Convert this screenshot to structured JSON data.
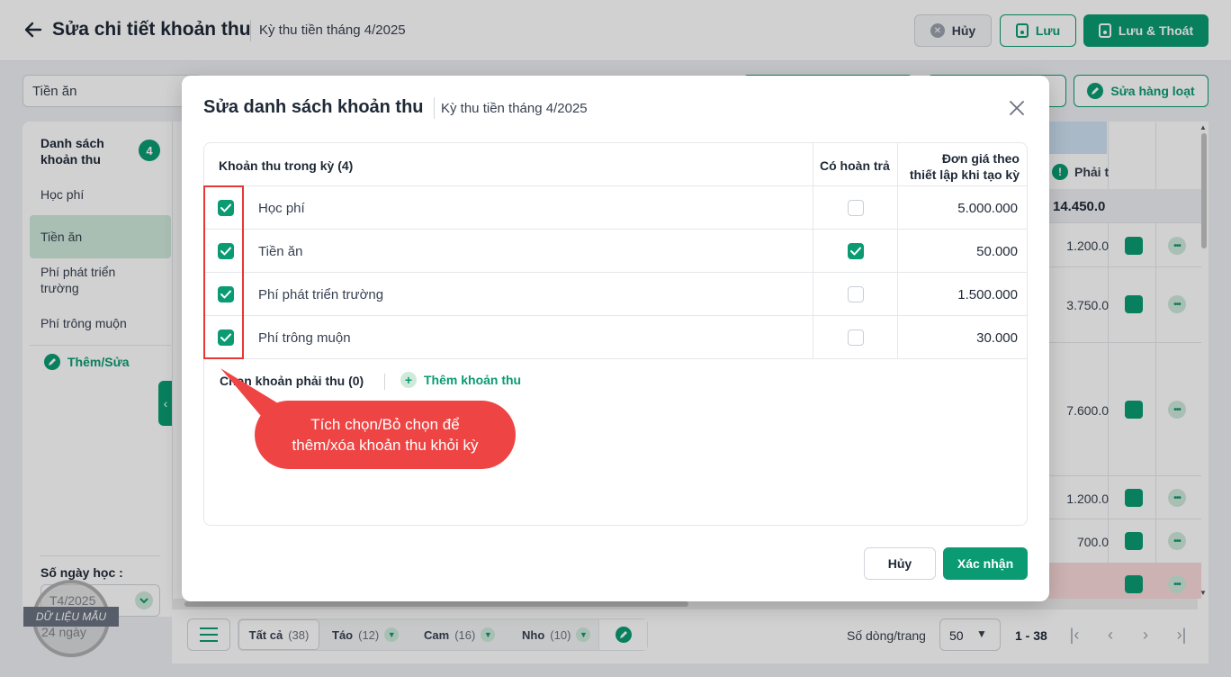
{
  "header": {
    "title": "Sửa chi tiết khoản thu",
    "subtitle": "Kỳ thu tiền tháng 4/2025",
    "cancel_label": "Hủy",
    "save_label": "Lưu",
    "save_exit_label": "Lưu & Thoát"
  },
  "toolbar": {
    "filter_value": "Tiền ăn",
    "bulk_edit_label": "Sửa hàng loạt"
  },
  "sidebar": {
    "title": "Danh sách khoản thu",
    "count": "4",
    "items": [
      {
        "label": "Học phí"
      },
      {
        "label": "Tiền ăn"
      },
      {
        "label": "Phí phát triển trường"
      },
      {
        "label": "Phí trông muộn"
      }
    ],
    "active_index": 1,
    "add_edit_label": "Thêm/Sửa",
    "days_label": "Số ngày học :",
    "days_select": "T4/2025",
    "days_value": "24 ngày"
  },
  "grid": {
    "column_header": "Phải t",
    "total": "14.450.0",
    "values": [
      "1.200.0",
      "3.750.0",
      "7.600.0",
      "1.200.0",
      "700.0"
    ]
  },
  "footer": {
    "tabs": [
      {
        "label": "Tất cả",
        "count": "(38)"
      },
      {
        "label": "Táo",
        "count": "(12)"
      },
      {
        "label": "Cam",
        "count": "(16)"
      },
      {
        "label": "Nho",
        "count": "(10)"
      }
    ],
    "rows_label": "Số dòng/trang",
    "rows_value": "50",
    "range": "1 - 38"
  },
  "watermark": {
    "label": "DỮ LIỆU MẪU"
  },
  "modal": {
    "title": "Sửa danh sách khoản thu",
    "subtitle": "Kỳ thu tiền tháng 4/2025",
    "table": {
      "col_name": "Khoản thu trong kỳ (4)",
      "col_refund": "Có hoàn trả",
      "col_price_line1": "Đơn giá theo",
      "col_price_line2": "thiết lập khi tạo kỳ",
      "rows": [
        {
          "name": "Học phí",
          "selected": true,
          "refund": false,
          "price": "5.000.000"
        },
        {
          "name": "Tiền ăn",
          "selected": true,
          "refund": true,
          "price": "50.000"
        },
        {
          "name": "Phí phát triển trường",
          "selected": true,
          "refund": false,
          "price": "1.500.000"
        },
        {
          "name": "Phí trông muộn",
          "selected": true,
          "refund": false,
          "price": "30.000"
        }
      ]
    },
    "section_label": "Chọn khoản phải thu (0)",
    "add_label": "Thêm khoản thu",
    "cancel_label": "Hủy",
    "confirm_label": "Xác nhận"
  },
  "annotation": {
    "line1": "Tích chọn/Bỏ chọn để",
    "line2": "thêm/xóa khoản thu khỏi kỳ",
    "color": "#ef4444"
  },
  "colors": {
    "primary": "#0a9b72",
    "primary_light": "#cfe9db",
    "danger": "#e53935"
  }
}
